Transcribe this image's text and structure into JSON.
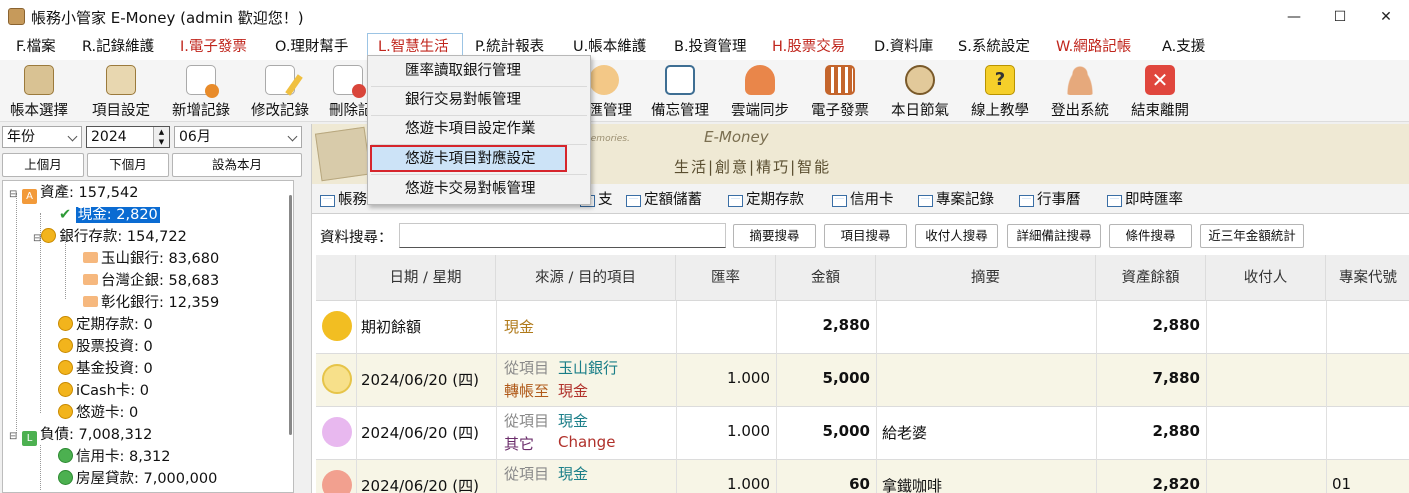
{
  "window": {
    "title": "帳務小管家 E-Money (admin 歡迎您！)",
    "minimize": "—",
    "maximize": "☐",
    "close": "✕"
  },
  "menubar": [
    {
      "label": "F.檔案",
      "color": "#111111"
    },
    {
      "label": "R.記錄維護",
      "color": "#111111"
    },
    {
      "label": "I.電子發票",
      "color": "#c0261d"
    },
    {
      "label": "O.理財幫手",
      "color": "#111111"
    },
    {
      "label": "L.智慧生活",
      "color": "#c0261d"
    },
    {
      "label": "P.統計報表",
      "color": "#111111"
    },
    {
      "label": "U.帳本維護",
      "color": "#111111"
    },
    {
      "label": "B.投資管理",
      "color": "#111111"
    },
    {
      "label": "H.股票交易",
      "color": "#c0261d"
    },
    {
      "label": "D.資料庫",
      "color": "#111111"
    },
    {
      "label": "S.系統設定",
      "color": "#111111"
    },
    {
      "label": "W.網路記帳",
      "color": "#c0261d"
    },
    {
      "label": "A.支援",
      "color": "#111111"
    }
  ],
  "toolbar": [
    {
      "label": "帳本選擇",
      "icon": "ledger-book-icon"
    },
    {
      "label": "項目設定",
      "icon": "settings-clipboard-icon"
    },
    {
      "label": "新增記錄",
      "icon": "add-record-icon"
    },
    {
      "label": "修改記錄",
      "icon": "edit-record-icon"
    },
    {
      "label": "刪除記",
      "icon": "delete-record-icon"
    },
    {
      "label": "匯管理",
      "icon": "exchange-icon"
    },
    {
      "label": "備忘管理",
      "icon": "memo-icon"
    },
    {
      "label": "雲端同步",
      "icon": "cloud-sync-icon"
    },
    {
      "label": "電子發票",
      "icon": "qr-invoice-icon"
    },
    {
      "label": "本日節氣",
      "icon": "solar-term-icon"
    },
    {
      "label": "線上教學",
      "icon": "help-icon"
    },
    {
      "label": "登出系統",
      "icon": "logout-icon"
    },
    {
      "label": "結束離開",
      "icon": "exit-icon"
    }
  ],
  "dropdown": {
    "items": [
      "匯率讀取銀行管理",
      "銀行交易對帳管理",
      "悠遊卡項目設定作業",
      "悠遊卡項目對應設定",
      "悠遊卡交易對帳管理"
    ],
    "highlighted_index": 3
  },
  "filters": {
    "period_type": "年份",
    "year": "2024",
    "month": "06月",
    "prev_month": "上個月",
    "next_month": "下個月",
    "set_current": "設為本月"
  },
  "tree": [
    {
      "label": "資產: 157,542",
      "badge": "A",
      "level": 0
    },
    {
      "label": "現金: 2,820",
      "level": 1,
      "selected": true
    },
    {
      "label": "銀行存款: 154,722",
      "level": 1
    },
    {
      "label": "玉山銀行: 83,680",
      "level": 2
    },
    {
      "label": "台灣企銀: 58,683",
      "level": 2
    },
    {
      "label": "彰化銀行: 12,359",
      "level": 2
    },
    {
      "label": "定期存款: 0",
      "level": 1
    },
    {
      "label": "股票投資: 0",
      "level": 1
    },
    {
      "label": "基金投資: 0",
      "level": 1
    },
    {
      "label": "iCash卡: 0",
      "level": 1
    },
    {
      "label": "悠遊卡: 0",
      "level": 1
    },
    {
      "label": "負債: 7,008,312",
      "badge": "L",
      "level": 0
    },
    {
      "label": "信用卡: 8,312",
      "level": 1
    },
    {
      "label": "房屋貸款: 7,000,000",
      "level": 1
    }
  ],
  "banner": {
    "brand": "E-Money",
    "slogan": "生活|創意|精巧|智能",
    "memories": "memories."
  },
  "tabs": [
    "帳務",
    "",
    "支",
    "定額儲蓄",
    "定期存款",
    "信用卡",
    "專案記錄",
    "行事曆",
    "即時匯率"
  ],
  "search": {
    "label": "資料搜尋：",
    "value": "",
    "buttons": [
      "摘要搜尋",
      "項目搜尋",
      "收付人搜尋",
      "詳細備註搜尋",
      "條件搜尋",
      "近三年金額統計"
    ]
  },
  "table": {
    "headers": [
      "日期 / 星期",
      "來源 / 目的項目",
      "匯率",
      "金額",
      "摘要",
      "資產餘額",
      "收付人",
      "專案代號"
    ],
    "rows": [
      {
        "icon": "money-bag-icon",
        "date": "期初餘額",
        "from_label": "",
        "from": "現金",
        "to_label": "",
        "to": "",
        "rate": "",
        "amount": "2,880",
        "memo": "",
        "balance": "2,880",
        "payee": "",
        "project": ""
      },
      {
        "icon": "transfer-icon",
        "date": "2024/06/20 (四)",
        "from_label": "從項目",
        "from": "玉山銀行",
        "to_label": "轉帳至",
        "to": "現金",
        "rate": "1.000",
        "amount": "5,000",
        "memo": "",
        "balance": "7,880",
        "payee": "",
        "project": ""
      },
      {
        "icon": "exchange-arrows-icon",
        "date": "2024/06/20 (四)",
        "from_label": "從項目",
        "from": "現金",
        "to_label": "其它",
        "to": "Change",
        "rate": "1.000",
        "amount": "5,000",
        "memo": "給老婆",
        "balance": "2,880",
        "payee": "",
        "project": ""
      },
      {
        "icon": "expense-icon",
        "date": "2024/06/20 (四)",
        "from_label": "從項目",
        "from": "現金",
        "to_label": "",
        "to": "",
        "rate": "1.000",
        "amount": "60",
        "memo": "拿鐵咖啡",
        "balance": "2,820",
        "payee": "",
        "project": "01"
      }
    ]
  }
}
